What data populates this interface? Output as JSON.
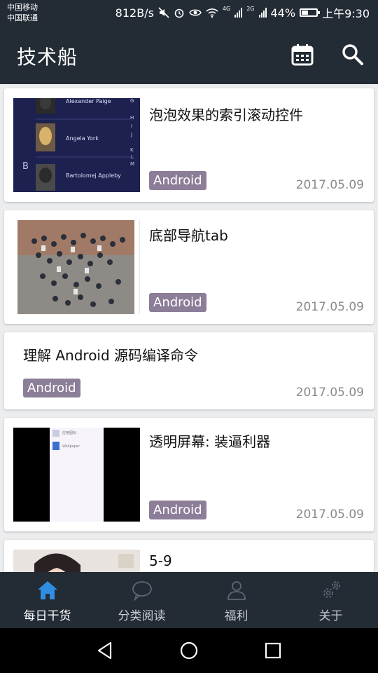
{
  "status_bar": {
    "carrier1": "中国移动",
    "carrier2": "中国联通",
    "speed": "812B/s",
    "net1": "4G",
    "net2": "2G",
    "battery": "44%",
    "battery_level": 0.44,
    "time": "上午9:30"
  },
  "toolbar": {
    "title": "技术船",
    "calendar_icon": "calendar-icon",
    "search_icon": "search-icon"
  },
  "cards": [
    {
      "title": "泡泡效果的索引滚动控件",
      "tag": "Android",
      "date": "2017.05.09",
      "thumb": {
        "names": [
          "Alexander Paige",
          "Angela York",
          "Bartolomej Appleby"
        ],
        "section": "B",
        "letters": [
          "G",
          "H",
          "I",
          "J",
          "K",
          "L",
          "M"
        ]
      }
    },
    {
      "title": "底部导航tab",
      "tag": "Android",
      "date": "2017.05.09"
    },
    {
      "title": "理解 Android 源码编译命令",
      "tag": "Android",
      "date": "2017.05.09"
    },
    {
      "title": "透明屏幕: 装逼利器",
      "tag": "Android",
      "date": "2017.05.09",
      "thumb": {
        "item1": "应用图标",
        "item2": "Wallpaper"
      }
    },
    {
      "title": "5-9"
    }
  ],
  "bottom_nav": {
    "items": [
      {
        "label": "每日干货",
        "icon": "home-icon",
        "active": true
      },
      {
        "label": "分类阅读",
        "icon": "chat-bubble-icon",
        "active": false
      },
      {
        "label": "福利",
        "icon": "person-icon",
        "active": false
      },
      {
        "label": "关于",
        "icon": "gears-icon",
        "active": false
      }
    ],
    "active_color": "#2f8ee0"
  },
  "system_nav": {
    "back_icon": "back-triangle-icon",
    "home_icon": "home-circle-icon",
    "recents_icon": "recents-square-icon"
  }
}
